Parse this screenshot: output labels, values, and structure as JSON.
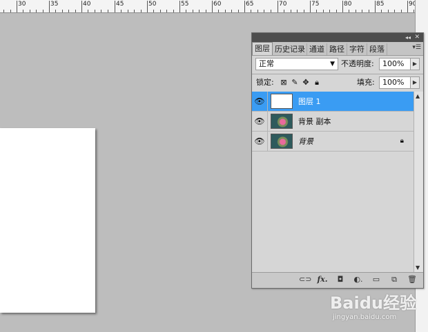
{
  "ruler": {
    "labels": [
      "30",
      "35",
      "40",
      "45",
      "50",
      "55",
      "60",
      "65",
      "70",
      "75",
      "80",
      "85",
      "90"
    ]
  },
  "panel": {
    "tabs": [
      "图层",
      "历史记录",
      "通道",
      "路径",
      "字符",
      "段落"
    ],
    "blend_mode": "正常",
    "opacity_label": "不透明度:",
    "opacity_value": "100%",
    "lock_label": "锁定:",
    "fill_label": "填充:",
    "fill_value": "100%",
    "layers": [
      {
        "name": "图层 1",
        "selected": true,
        "thumb": "white"
      },
      {
        "name": "背景 副本",
        "selected": false,
        "thumb": "photo"
      },
      {
        "name": "背景",
        "selected": false,
        "thumb": "photo",
        "locked": true
      }
    ],
    "footer_icons": [
      "link-icon",
      "fx-icon",
      "mask-icon",
      "adjustment-icon",
      "folder-icon",
      "new-layer-icon",
      "trash-icon"
    ]
  },
  "watermark": {
    "brand": "Baidu经验",
    "url": "jingyan.baidu.com"
  }
}
